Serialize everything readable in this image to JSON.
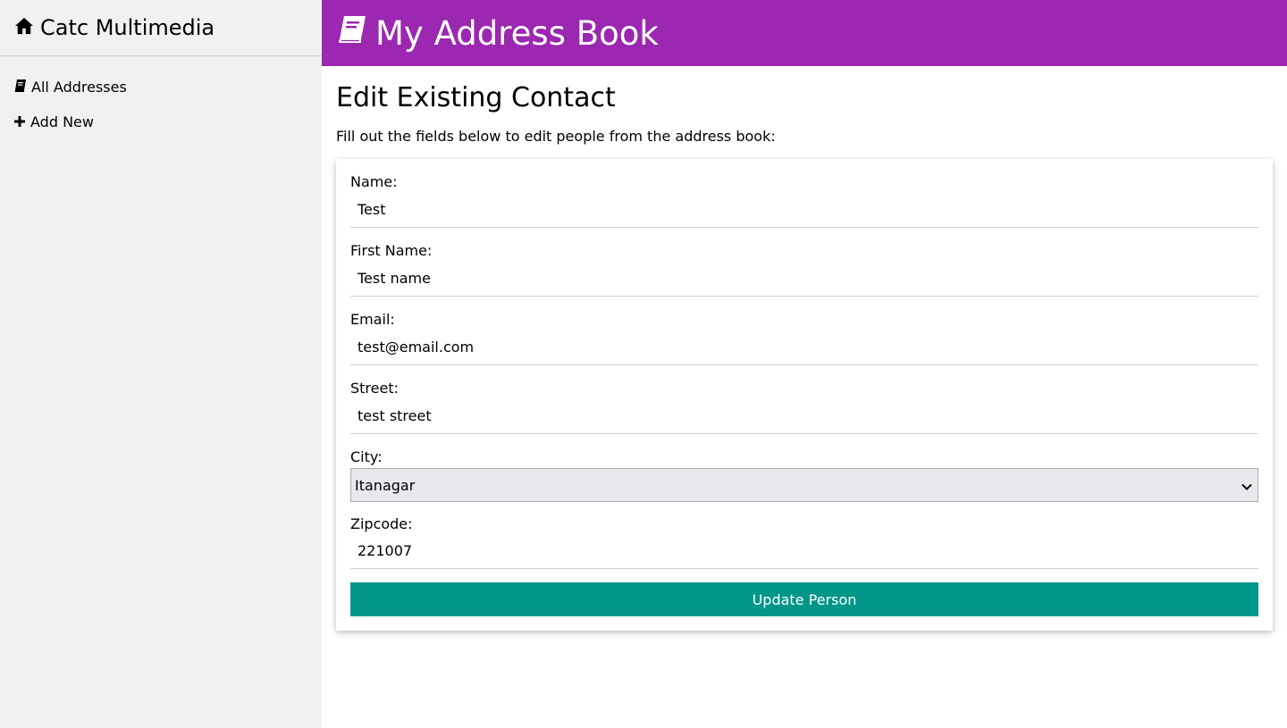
{
  "sidebar": {
    "brand": "Catc Multimedia",
    "items": [
      {
        "label": "All Addresses",
        "icon": "book-icon"
      },
      {
        "label": "Add New",
        "icon": "plus-icon"
      }
    ]
  },
  "banner": {
    "title": "My Address Book",
    "icon": "book-icon",
    "color": "#9c27b0"
  },
  "page": {
    "title": "Edit Existing Contact",
    "intro": "Fill out the fields below to edit people from the address book:"
  },
  "form": {
    "name": {
      "label": "Name:",
      "value": "Test"
    },
    "first_name": {
      "label": "First Name:",
      "value": "Test name"
    },
    "email": {
      "label": "Email:",
      "value": "test@email.com"
    },
    "street": {
      "label": "Street:",
      "value": "test street"
    },
    "city": {
      "label": "City:",
      "value": "Itanagar"
    },
    "zipcode": {
      "label": "Zipcode:",
      "value": "221007"
    },
    "submit_label": "Update Person",
    "submit_color": "#009688"
  }
}
